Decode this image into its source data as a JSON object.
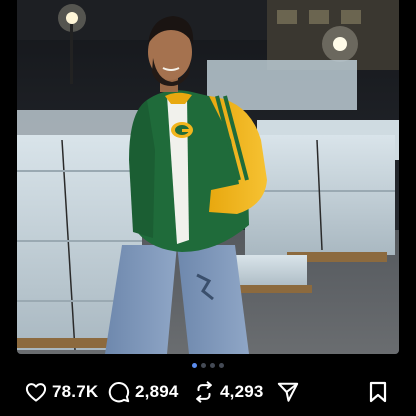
{
  "post": {
    "carousel": {
      "pages": 4,
      "active_index": 1
    },
    "actions": {
      "likes": "78.7K",
      "comments": "2,894",
      "reposts": "4,293"
    },
    "icons": {
      "like": "heart-icon",
      "comment": "comment-bubble-icon",
      "repost": "repost-arrows-icon",
      "share": "share-send-icon",
      "save": "bookmark-icon"
    },
    "colors": {
      "background": "#000000",
      "jacket_green": "#1f6b3a",
      "jacket_gold": "#f2b51c",
      "carousel_active": "#5b8def"
    }
  }
}
